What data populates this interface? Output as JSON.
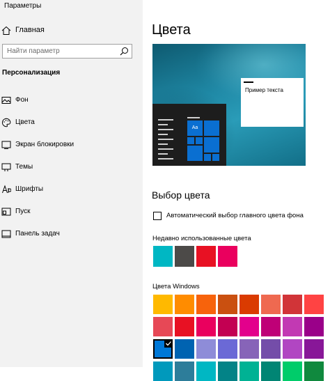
{
  "app": {
    "title": "Параметры"
  },
  "sidebar": {
    "home_label": "Главная",
    "search_placeholder": "Найти параметр",
    "section_title": "Персонализация",
    "items": [
      {
        "label": "Фон",
        "icon": "image-icon"
      },
      {
        "label": "Цвета",
        "icon": "palette-icon"
      },
      {
        "label": "Экран блокировки",
        "icon": "lock-screen-icon"
      },
      {
        "label": "Темы",
        "icon": "brush-icon"
      },
      {
        "label": "Шрифты",
        "icon": "font-icon"
      },
      {
        "label": "Пуск",
        "icon": "start-icon"
      },
      {
        "label": "Панель задач",
        "icon": "taskbar-icon"
      }
    ]
  },
  "main": {
    "page_title": "Цвета",
    "preview": {
      "sample_text": "Пример текста",
      "tile_text": "Aa"
    },
    "choose_color_title": "Выбор цвета",
    "auto_color_label": "Автоматический выбор главного цвета фона",
    "auto_color_checked": false,
    "recent_label": "Недавно использованные цвета",
    "recent_colors": [
      "#00b7c3",
      "#4c4a48",
      "#e81123",
      "#ea005e"
    ],
    "windows_colors_label": "Цвета Windows",
    "windows_colors": [
      [
        "#ffb900",
        "#ff8c00",
        "#f7630c",
        "#ca5010",
        "#da3b01",
        "#ef6950",
        "#d13438",
        "#ff4343"
      ],
      [
        "#e74856",
        "#e81123",
        "#ea005e",
        "#c30052",
        "#e3008c",
        "#bf0077",
        "#c239b3",
        "#9a0089"
      ],
      [
        "#0078d7",
        "#0063b1",
        "#8e8cd8",
        "#6b69d6",
        "#8764b8",
        "#744da9",
        "#b146c2",
        "#881798"
      ],
      [
        "#0099bc",
        "#2d7d9a",
        "#00b7c3",
        "#038387",
        "#00b294",
        "#018574",
        "#00cc6a",
        "#10893e"
      ]
    ],
    "selected_color": "#0078d7"
  }
}
